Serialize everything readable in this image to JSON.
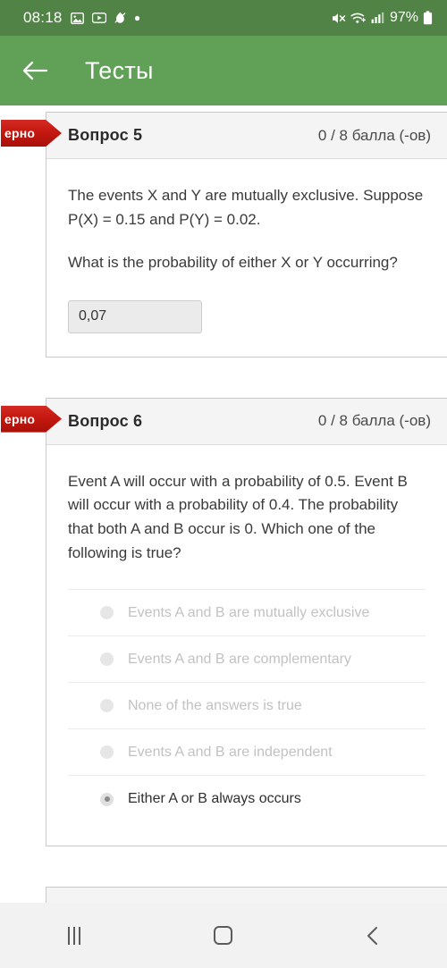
{
  "status_bar": {
    "time": "08:18",
    "left_icons": [
      "photo-icon",
      "youtube-icon",
      "app-icon",
      "dot-icon"
    ],
    "right_icons": [
      "mute-icon",
      "wifi-icon",
      "signal-icon"
    ],
    "battery_percent": "97%",
    "background_color": "#518246"
  },
  "app_bar": {
    "back_icon": "back-arrow-icon",
    "title": "Тесты",
    "background_color": "#60a157"
  },
  "questions": [
    {
      "ribbon_label": "ерно",
      "ribbon_color": "#c41810",
      "title": "Вопрос 5",
      "score": "0 / 8 балла (-ов)",
      "paragraphs": [
        "The events X and Y are mutually exclusive. Suppose P(X) = 0.15 and P(Y) = 0.02.",
        "What is the probability of either X or Y occurring?"
      ],
      "answer_type": "text",
      "answer_value": "0,07"
    },
    {
      "ribbon_label": "ерно",
      "ribbon_color": "#c41810",
      "title": "Вопрос 6",
      "score": "0 / 8 балла (-ов)",
      "paragraphs": [
        "Event A will occur with a probability of 0.5. Event B will occur with a probability of 0.4. The probability that both A and B occur is 0. Which one of the following is true?"
      ],
      "answer_type": "radio",
      "options": [
        {
          "label": "Events A and B are mutually exclusive",
          "selected": false
        },
        {
          "label": "Events A and B are complementary",
          "selected": false
        },
        {
          "label": "None of the answers is true",
          "selected": false
        },
        {
          "label": "Events A and B are independent",
          "selected": false
        },
        {
          "label": "Either A or B always occurs",
          "selected": true
        }
      ]
    }
  ],
  "nav_bar": {
    "recents_label": "recents-icon",
    "home_label": "home-icon",
    "back_label": "back-icon"
  }
}
